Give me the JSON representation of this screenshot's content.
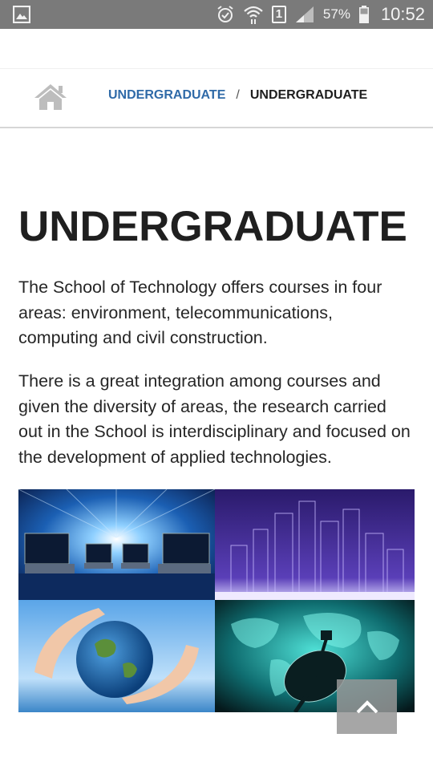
{
  "status_bar": {
    "battery_percent": "57%",
    "time": "10:52",
    "sim_slot": "1",
    "icons": [
      "gallery-icon",
      "alarm-icon",
      "wifi-icon",
      "sim-icon",
      "signal-icon",
      "battery-icon"
    ]
  },
  "breadcrumb": {
    "home_icon": "home-icon",
    "parent": "UNDERGRADUATE",
    "separator": "/",
    "current": "UNDERGRADUATE"
  },
  "main": {
    "title": "UNDERGRADUATE",
    "paragraphs": [
      "The School of Technology offers courses in four areas: environment, telecommunications, computing and civil construction.",
      "There is a great integration among courses and given the diversity of areas, the research carried out in the School is interdisciplinary and focused on the development of applied technologies."
    ]
  },
  "colors": {
    "link": "#2f6aa8",
    "status_bar": "#7a7a7a",
    "title": "#1f1f1f"
  },
  "back_to_top": {
    "icon": "chevron-up-icon"
  }
}
